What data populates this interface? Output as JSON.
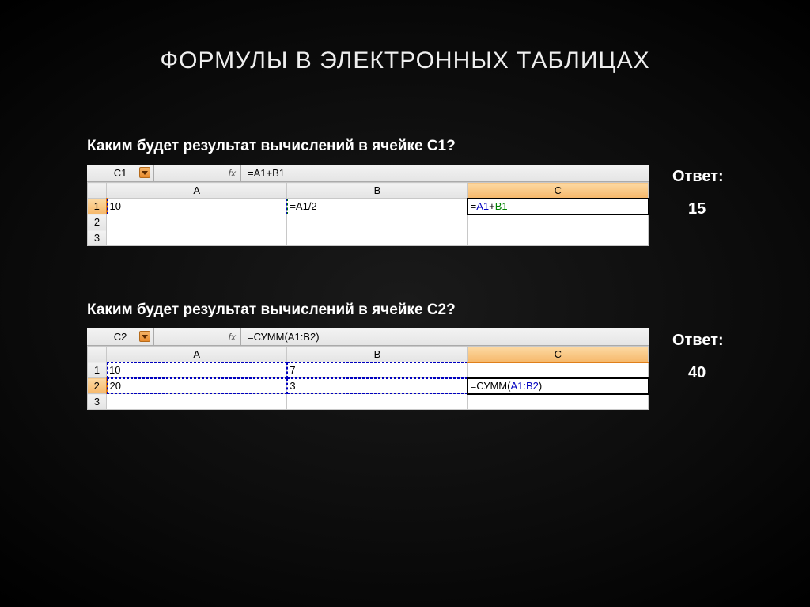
{
  "title": "ФОРМУЛЫ В ЭЛЕКТРОННЫХ ТАБЛИЦАХ",
  "q1": {
    "question": "Каким будет результат вычислений в ячейке С1?",
    "name_box": "C1",
    "fx_label": "fx",
    "formula": "=A1+B1",
    "columns": [
      "A",
      "B",
      "C"
    ],
    "rows": [
      "1",
      "2",
      "3"
    ],
    "a1": "10",
    "b1": "=A1/2",
    "c1_raw": "=A1+B1",
    "c1_part_eq": "=",
    "c1_part_a1": "A1",
    "c1_part_plus": "+",
    "c1_part_b1": "B1",
    "answer_label": "Ответ:",
    "answer_value": "15"
  },
  "q2": {
    "question": "Каким будет результат вычислений в ячейке С2?",
    "name_box": "C2",
    "fx_label": "fx",
    "formula": "=СУММ(A1:B2)",
    "columns": [
      "A",
      "B",
      "C"
    ],
    "rows": [
      "1",
      "2",
      "3"
    ],
    "a1": "10",
    "b1": "7",
    "a2": "20",
    "b2": "3",
    "c2_raw": "=СУММ(A1:B2)",
    "c2_part_eq": "=СУММ(",
    "c2_part_range": "A1:B2",
    "c2_part_close": ")",
    "answer_label": "Ответ:",
    "answer_value": "40"
  }
}
